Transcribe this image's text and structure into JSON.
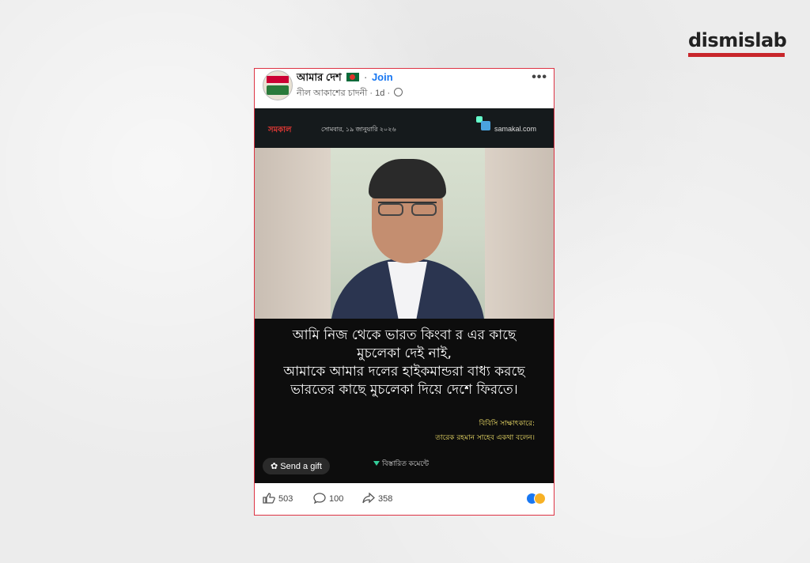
{
  "brand": {
    "name": "dismislab",
    "accent": "#c8262b"
  },
  "post": {
    "group_name": "আমার দেশ",
    "join_label": "Join",
    "author": "নীল আকাশের চাদনী",
    "time": "1d",
    "more_label": "•••"
  },
  "newsbar": {
    "outlet": "সমকাল",
    "date": "সোমবার, ১৯ জানুয়ারি ২০২৬",
    "site": "samakal.com"
  },
  "quote": {
    "lines": [
      "আমি নিজ থেকে ভারত কিংবা র এর কাছে",
      "মুচলেকা দেই নাই,",
      "আমাকে আমার দলের হাইকমান্ডরা বাধ্য করছে",
      "ভারতের কাছে মুচলেকা দিয়ে দেশে ফিরতে।"
    ],
    "credit_line1": "বিবিসি সাক্ষাৎকারে:",
    "credit_line2": "তারেক রহমান সাহেব একথা বলেন।"
  },
  "overlay": {
    "gift_label": "Send a gift",
    "more_comment": "বিস্তারিত কমেন্টে"
  },
  "actions": {
    "likes": "503",
    "comments": "100",
    "shares": "358"
  },
  "icons": [
    "thumbs-up-icon",
    "comment-icon",
    "share-icon",
    "globe-icon",
    "gift-icon",
    "more-icon"
  ]
}
